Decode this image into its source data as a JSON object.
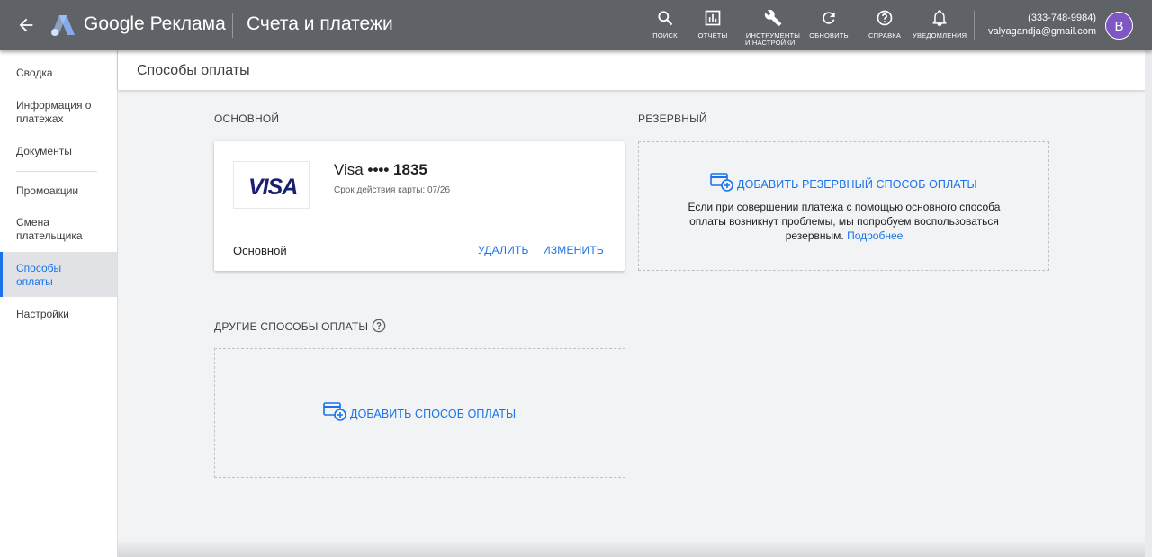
{
  "topbar": {
    "brand_google": "Google",
    "brand_product": "Реклама",
    "page_title": "Счета и платежи",
    "tools": [
      {
        "label": "ПОИСК",
        "icon": "search-icon"
      },
      {
        "label": "ОТЧЕТЫ",
        "icon": "reports-icon"
      },
      {
        "label": "ИНСТРУМЕНТЫ И НАСТРОЙКИ",
        "label_line1": "ИНСТРУМЕНТЫ",
        "label_line2": "И НАСТРОЙКИ",
        "icon": "wrench-icon"
      },
      {
        "label": "ОБНОВИТЬ",
        "icon": "refresh-icon"
      },
      {
        "label": "СПРАВКА",
        "icon": "help-icon"
      },
      {
        "label": "УВЕДОМЛЕНИЯ",
        "icon": "bell-icon"
      }
    ],
    "account_phone": "(333-748-9984)",
    "account_email": "valyagandja@gmail.com",
    "avatar_letter": "В"
  },
  "sidebar": {
    "items": [
      {
        "label": "Сводка"
      },
      {
        "label": "Информация о платежах"
      },
      {
        "label": "Документы"
      },
      {
        "label": "Промоакции"
      },
      {
        "label": "Смена плательщика"
      },
      {
        "label": "Способы оплаты",
        "active": true
      },
      {
        "label": "Настройки"
      }
    ]
  },
  "main": {
    "header_title": "Способы оплаты",
    "primary": {
      "section_label": "ОСНОВНОЙ",
      "card_brand": "Visa",
      "card_mask": "•••• 1835",
      "expiry": "Срок действия карты: 07/26",
      "logo_text": "VISA",
      "status": "Основной",
      "delete_label": "УДАЛИТЬ",
      "edit_label": "ИЗМЕНИТЬ"
    },
    "backup": {
      "section_label": "РЕЗЕРВНЫЙ",
      "add_label": "ДОБАВИТЬ РЕЗЕРВНЫЙ СПОСОБ ОПЛАТЫ",
      "description": "Если при совершении платежа с помощью основного способа оплаты возникнут проблемы, мы попробуем воспользоваться резервным.",
      "learn_more": "Подробнее"
    },
    "other": {
      "section_label": "ДРУГИЕ СПОСОБЫ ОПЛАТЫ",
      "add_label": "ДОБАВИТЬ СПОСОБ ОПЛАТЫ"
    }
  },
  "colors": {
    "topbar": "#5f6368",
    "accent": "#1a73e8",
    "avatar": "#7e57c2"
  }
}
